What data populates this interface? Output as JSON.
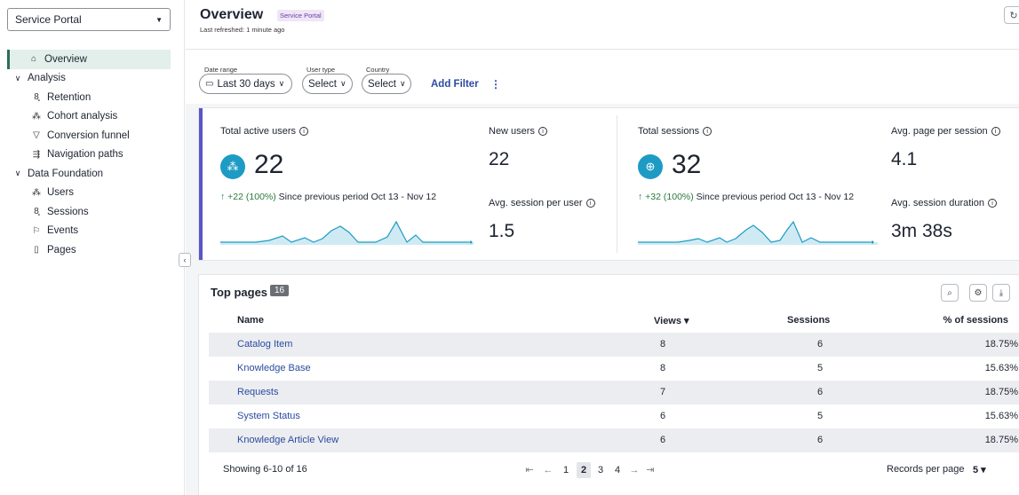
{
  "sidebar": {
    "portal_select": "Service Portal",
    "items": [
      {
        "label": "Overview",
        "icon": "home-icon"
      },
      {
        "label": "Analysis"
      },
      {
        "label": "Retention",
        "icon": "retention-icon"
      },
      {
        "label": "Cohort analysis",
        "icon": "cohort-icon"
      },
      {
        "label": "Conversion funnel",
        "icon": "funnel-icon"
      },
      {
        "label": "Navigation paths",
        "icon": "paths-icon"
      },
      {
        "label": "Data Foundation"
      },
      {
        "label": "Users",
        "icon": "users-icon"
      },
      {
        "label": "Sessions",
        "icon": "sessions-icon"
      },
      {
        "label": "Events",
        "icon": "flag-icon"
      },
      {
        "label": "Pages",
        "icon": "page-icon"
      }
    ]
  },
  "header": {
    "title": "Overview",
    "badge": "Service Portal",
    "subtitle": "Last refreshed: 1 minute ago"
  },
  "filters": {
    "date_range_label": "Date range",
    "date_range_value": "Last 30 days",
    "user_type_label": "User type",
    "user_type_value": "Select",
    "country_label": "Country",
    "country_value": "Select",
    "add_filter": "Add Filter"
  },
  "metrics": {
    "total_active_users": {
      "label": "Total active users",
      "value": "22",
      "delta": "↑ +22 (100%)",
      "delta_text": "Since previous period Oct 13 - Nov 12"
    },
    "new_users": {
      "label": "New users",
      "value": "22"
    },
    "avg_session_per_user": {
      "label": "Avg. session per user",
      "value": "1.5"
    },
    "total_sessions": {
      "label": "Total sessions",
      "value": "32",
      "delta": "↑ +32 (100%)",
      "delta_text": "Since previous period Oct 13 - Nov 12"
    },
    "avg_page_per_session": {
      "label": "Avg. page per session",
      "value": "4.1"
    },
    "avg_session_duration": {
      "label": "Avg. session duration",
      "value": "3m 38s"
    }
  },
  "top_pages": {
    "title": "Top pages",
    "count": "16",
    "columns": [
      "Name",
      "Views ▾",
      "Sessions",
      "% of sessions"
    ],
    "rows": [
      {
        "name": "Catalog Item",
        "views": "8",
        "sessions": "6",
        "pct": "18.75%"
      },
      {
        "name": "Knowledge Base",
        "views": "8",
        "sessions": "5",
        "pct": "15.63%"
      },
      {
        "name": "Requests",
        "views": "7",
        "sessions": "6",
        "pct": "18.75%"
      },
      {
        "name": "System Status",
        "views": "6",
        "sessions": "5",
        "pct": "15.63%"
      },
      {
        "name": "Knowledge Article View",
        "views": "6",
        "sessions": "6",
        "pct": "18.75%"
      }
    ],
    "showing": "Showing 6-10 of 16",
    "pages": [
      "1",
      "2",
      "3",
      "4"
    ],
    "current_page": "2",
    "records_label": "Records per page",
    "records_value": "5 ▾"
  },
  "colors": {
    "accent": "#5a55c6",
    "metric_icon": "#1d9bc4",
    "link": "#2b4ba0",
    "active_nav": "#e2efea"
  }
}
